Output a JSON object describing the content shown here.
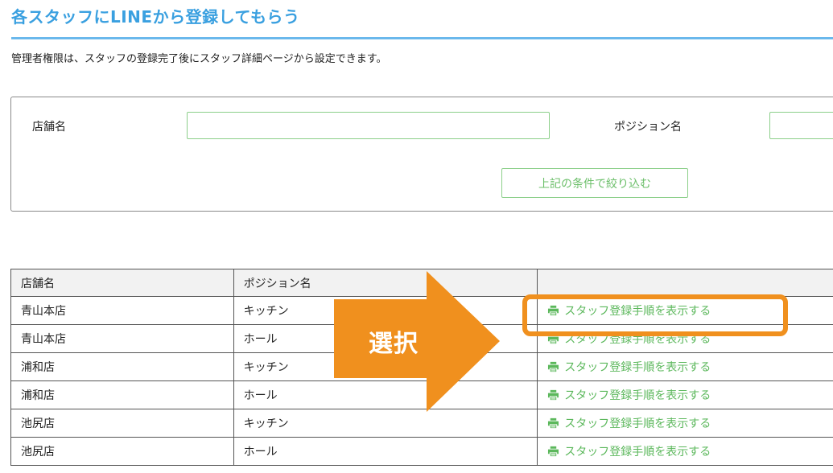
{
  "page": {
    "title": "各スタッフにLINEから登録してもらう",
    "description": "管理者権限は、スタッフの登録完了後にスタッフ詳細ページから設定できます。"
  },
  "filter": {
    "store_label": "店舗名",
    "store_value": "",
    "position_label": "ポジション名",
    "position_value": "",
    "submit_label": "上記の条件で絞り込む"
  },
  "table": {
    "headers": [
      "店舗名",
      "ポジション名",
      ""
    ],
    "rows": [
      {
        "store": "青山本店",
        "position": "キッチン",
        "action": "スタッフ登録手順を表示する"
      },
      {
        "store": "青山本店",
        "position": "ホール",
        "action": "スタッフ登録手順を表示する"
      },
      {
        "store": "浦和店",
        "position": "キッチン",
        "action": "スタッフ登録手順を表示する"
      },
      {
        "store": "浦和店",
        "position": "ホール",
        "action": "スタッフ登録手順を表示する"
      },
      {
        "store": "池尻店",
        "position": "キッチン",
        "action": "スタッフ登録手順を表示する"
      },
      {
        "store": "池尻店",
        "position": "ホール",
        "action": "スタッフ登録手順を表示する"
      }
    ]
  },
  "annotation": {
    "arrow_label": "選択",
    "color": "#f0901e"
  },
  "colors": {
    "title": "#3aa0e0",
    "link": "#5cb85c",
    "input_border": "#8ccf8a"
  },
  "icons": {
    "action": "printer-icon"
  }
}
